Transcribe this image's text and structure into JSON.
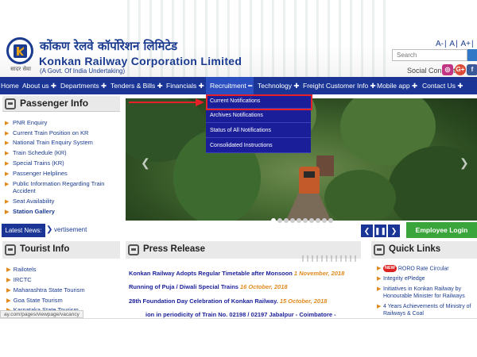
{
  "header": {
    "org_hindi": "कोंकण रेलवे कॉर्पोरेशन लिमिटेड",
    "org_name": "Konkan Railway Corporation Limited",
    "org_govt": "(A Govt. Of India Undertaking)",
    "motto": "सादर सेवा",
    "font_sizes": [
      "A-",
      "A",
      "A+"
    ],
    "search_placeholder": "Search",
    "social_label": "Social Connect :"
  },
  "nav": {
    "items": [
      {
        "label": "Home"
      },
      {
        "label": "About us ✚"
      },
      {
        "label": "Departments ✚"
      },
      {
        "label": "Tenders & Bills ✚"
      },
      {
        "label": "Financials ✚"
      },
      {
        "label": "Recruitment ━"
      },
      {
        "label": "Technology ✚"
      },
      {
        "label": "Freight Customer Info ✚"
      },
      {
        "label": "Mobile app ✚"
      },
      {
        "label": "Contact Us ✚"
      }
    ],
    "active_index": 5
  },
  "recruitment_menu": [
    "Current Notifications",
    "Archives Notifications",
    "Status of All Notifications",
    "Consolidated Instructions"
  ],
  "passenger_info": {
    "title": "Passenger Info",
    "items": [
      "PNR Enquiry",
      "Current Train Position on KR",
      "National Train Enquiry System",
      "Train Schedule (KR)",
      "Special Trains (KR)",
      "Passenger Helplines",
      "Public Information Regarding Train",
      "Accident",
      "Seat Availability",
      "Station Gallery"
    ]
  },
  "news": {
    "label": "Latest News:",
    "text": "vertisement",
    "controls": [
      "❮",
      "❚❚",
      "❯"
    ],
    "employee_login": "Employee Login"
  },
  "tourist_info": {
    "title": "Tourist Info",
    "items": [
      "Railotels",
      "IRCTC",
      "Maharashtra State Tourism",
      "Goa State Tourism",
      "Karnataka State Tourism"
    ]
  },
  "press_release": {
    "title": "Press Release",
    "items": [
      {
        "title": "Konkan Railway Adopts Regular Timetable after Monsoon",
        "date": "1 November, 2018"
      },
      {
        "title": "Running of Puja / Diwali Special Trains",
        "date": "16 October, 2018"
      },
      {
        "title": "28th Foundation Day Celebration of Konkan Railway.",
        "date": "15 October, 2018"
      },
      {
        "title": "ion in periodicity of Train No. 02198 / 02197 Jabalpur - Coimbatore -",
        "date": ""
      }
    ]
  },
  "quick_links": {
    "title": "Quick Links",
    "badge": "NEW",
    "items": [
      "RORO Rate Circular",
      "Integrity ePledge",
      "Initiatives in Konkan Railway by Honourable Minister for Railways",
      "4 Years Achievements of Ministry of Railways & Coal"
    ]
  },
  "status_url": "ay.com/pages/viewpage/vacancy",
  "colors": {
    "nav": "#1a3596",
    "link": "#1a3b8f",
    "accent": "#e08a1e",
    "highlight": "#e8202a",
    "login": "#3aa53a"
  }
}
